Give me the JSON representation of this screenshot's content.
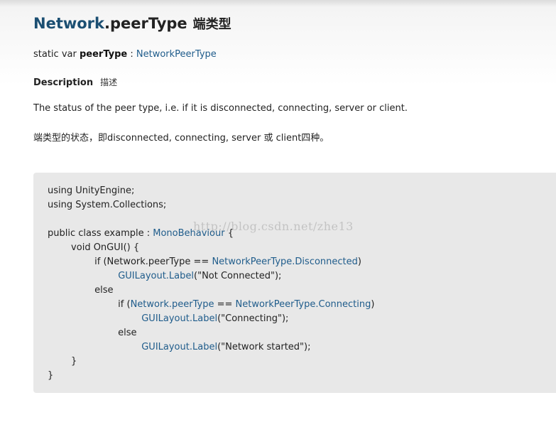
{
  "header": {
    "class_name": "Network",
    "member_name": ".peerType",
    "title_cjk": "端类型"
  },
  "signature": {
    "prefix": "static var ",
    "name": "peerType",
    "separator": " : ",
    "type": "NetworkPeerType"
  },
  "description": {
    "heading": "Description",
    "heading_cjk": "描述",
    "text_en": "The status of the peer type, i.e. if it is disconnected, connecting, server or client.",
    "text_cjk": "端类型的状态，即disconnected, connecting, server 或 client四种。"
  },
  "code": {
    "lines": [
      [
        {
          "t": "using UnityEngine;"
        }
      ],
      [
        {
          "t": "using System.Collections;"
        }
      ],
      [],
      [
        {
          "t": "public class example : "
        },
        {
          "t": "MonoBehaviour",
          "link": true
        },
        {
          "t": " {"
        }
      ],
      [
        {
          "t": "        void OnGUI() {"
        }
      ],
      [
        {
          "t": "                if (Network.peerType == "
        },
        {
          "t": "NetworkPeerType.Disconnected",
          "link": true
        },
        {
          "t": ")"
        }
      ],
      [
        {
          "t": "                        "
        },
        {
          "t": "GUILayout.Label",
          "link": true
        },
        {
          "t": "(\"Not Connected\");"
        }
      ],
      [
        {
          "t": "                else"
        }
      ],
      [
        {
          "t": "                        if ("
        },
        {
          "t": "Network.peerType",
          "link": true
        },
        {
          "t": " == "
        },
        {
          "t": "NetworkPeerType.Connecting",
          "link": true
        },
        {
          "t": ")"
        }
      ],
      [
        {
          "t": "                                "
        },
        {
          "t": "GUILayout.Label",
          "link": true
        },
        {
          "t": "(\"Connecting\");"
        }
      ],
      [
        {
          "t": "                        else"
        }
      ],
      [
        {
          "t": "                                "
        },
        {
          "t": "GUILayout.Label",
          "link": true
        },
        {
          "t": "(\"Network started\");"
        }
      ],
      [
        {
          "t": "        }"
        }
      ],
      [
        {
          "t": "}"
        }
      ]
    ]
  },
  "watermark": "http://blog.csdn.net/zhe13",
  "colors": {
    "link": "#1f5c8b",
    "title_class": "#1b4f72",
    "code_bg": "#e8e8e8"
  }
}
